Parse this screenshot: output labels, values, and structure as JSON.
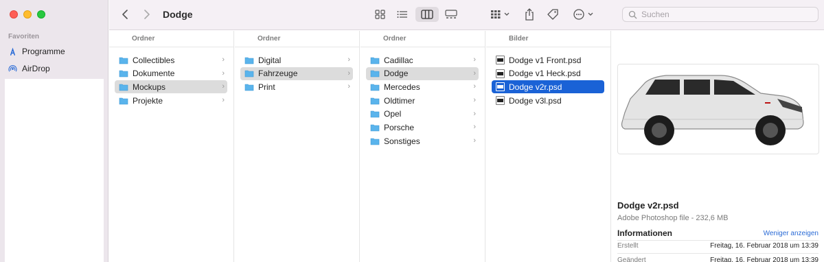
{
  "sidebar": {
    "heading": "Favoriten",
    "items": [
      {
        "label": "Programme",
        "icon": "apps-icon"
      },
      {
        "label": "AirDrop",
        "icon": "airdrop-icon"
      }
    ]
  },
  "toolbar": {
    "title": "Dodge",
    "search_placeholder": "Suchen"
  },
  "columns": [
    {
      "header": "Ordner",
      "items": [
        {
          "label": "Collectibles"
        },
        {
          "label": "Dokumente"
        },
        {
          "label": "Mockups"
        },
        {
          "label": "Projekte"
        }
      ]
    },
    {
      "header": "Ordner",
      "items": [
        {
          "label": "Digital"
        },
        {
          "label": "Fahrzeuge"
        },
        {
          "label": "Print"
        }
      ]
    },
    {
      "header": "Ordner",
      "items": [
        {
          "label": "Cadillac"
        },
        {
          "label": "Dodge"
        },
        {
          "label": "Mercedes"
        },
        {
          "label": "Oldtimer"
        },
        {
          "label": "Opel"
        },
        {
          "label": "Porsche"
        },
        {
          "label": "Sonstiges"
        }
      ]
    },
    {
      "header": "Bilder",
      "items": [
        {
          "label": "Dodge v1 Front.psd"
        },
        {
          "label": "Dodge v1 Heck.psd"
        },
        {
          "label": "Dodge v2r.psd"
        },
        {
          "label": "Dodge v3l.psd"
        }
      ]
    }
  ],
  "preview": {
    "name": "Dodge v2r.psd",
    "type": "Adobe Photoshop file - 232,6 MB",
    "info_heading": "Informationen",
    "show_less": "Weniger anzeigen",
    "rows": [
      {
        "key": "Erstellt",
        "value": "Freitag, 16. Februar 2018 um 13:39"
      },
      {
        "key": "Geändert",
        "value": "Freitag, 16. Februar 2018 um 13:39"
      }
    ]
  },
  "colors": {
    "accent": "#1a62d6",
    "folder": "#5ab4ec",
    "sidebar_bg": "#ece6ec"
  }
}
